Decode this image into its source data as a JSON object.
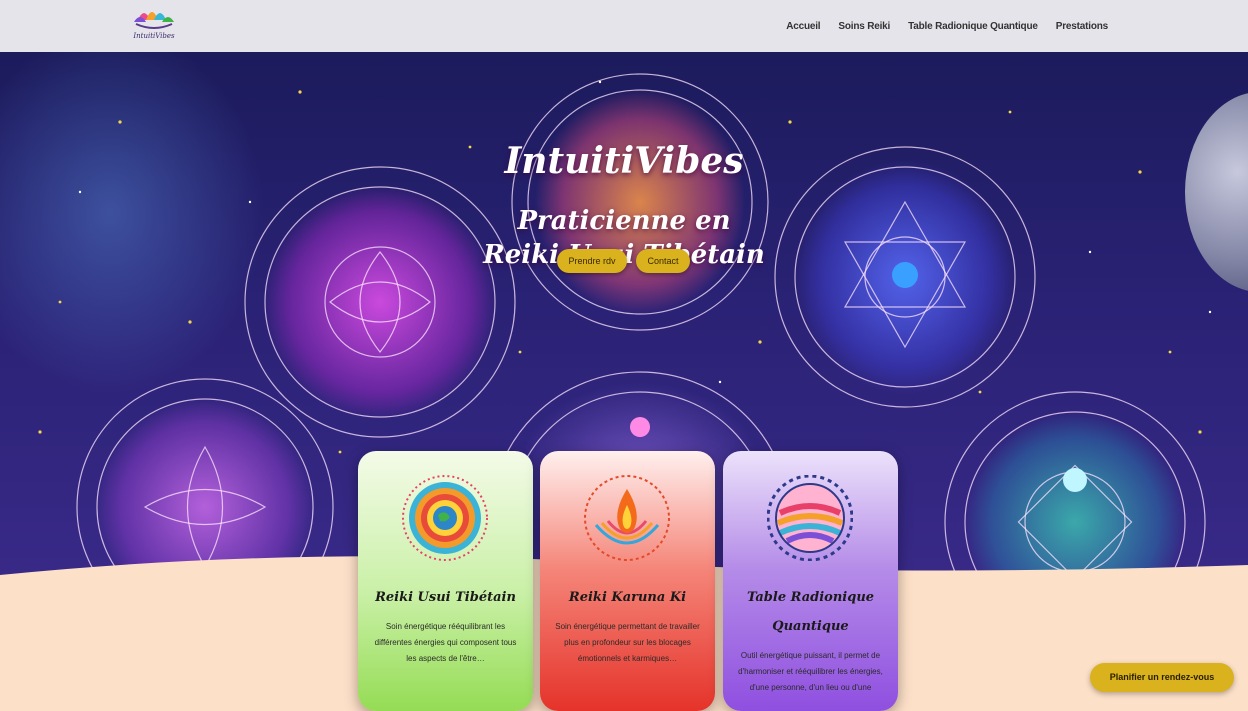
{
  "brand": {
    "logo_text": "IntuitiVibes"
  },
  "nav": {
    "items": [
      "Accueil",
      "Soins Reiki",
      "Table Radionique Quantique",
      "Prestations"
    ]
  },
  "hero": {
    "title": "IntuitiVibes",
    "subtitle_line1": "Praticienne en",
    "subtitle_line2": "Reiki Usui Tibétain",
    "btn_rdv": "Prendre rdv",
    "btn_contact": "Contact"
  },
  "cards": [
    {
      "title": "Reiki Usui Tibétain",
      "desc": "Soin énergétique rééquilibrant les différentes énergies qui composent tous les aspects de l'être…",
      "icon": "earth-mandala-icon",
      "color": "#95dc55"
    },
    {
      "title": "Reiki Karuna Ki",
      "desc": "Soin énergétique permettant de travailler plus en profondeur sur les blocages émotionnels et karmiques…",
      "icon": "lotus-flame-icon",
      "color": "#e5332a"
    },
    {
      "title": "Table Radionique Quantique",
      "desc": "Outil énergétique puissant, il permet de d'harmoniser et rééquilibrer les énergies, d'une personne, d'un lieu ou d'une",
      "icon": "rainbow-sphere-icon",
      "color": "#8f4fe0"
    }
  ],
  "cta": {
    "label": "Planifier un rendez-vous",
    "color": "#d9b21d"
  }
}
